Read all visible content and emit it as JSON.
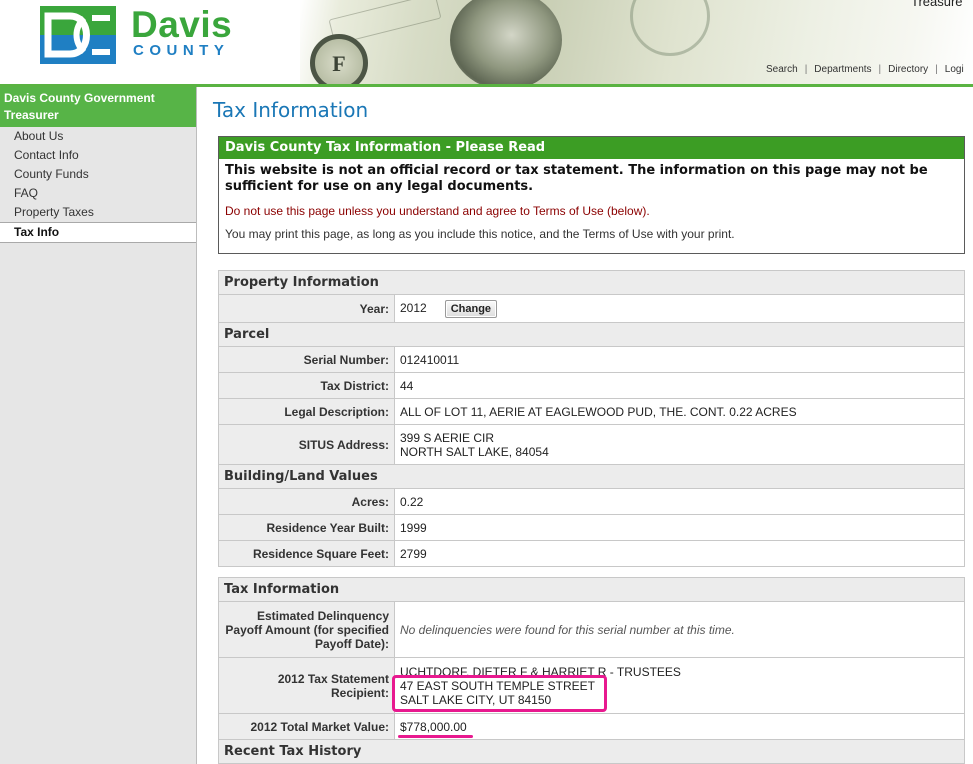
{
  "header": {
    "logo_davis": "Davis",
    "logo_county": "COUNTY",
    "top_right_text": "Treasure",
    "nav": [
      "Search",
      "Departments",
      "Directory",
      "Logi"
    ],
    "banner_seal_letter": "F",
    "accent_green": "#5ab342",
    "accent_blue": "#1f7fc3"
  },
  "sidebar": {
    "heading_line1": "Davis County Government",
    "heading_line2": "Treasurer",
    "items": [
      {
        "label": "About Us"
      },
      {
        "label": "Contact Info"
      },
      {
        "label": "County Funds"
      },
      {
        "label": "FAQ"
      },
      {
        "label": "Property Taxes"
      },
      {
        "label": "Tax Info",
        "active": true
      }
    ]
  },
  "main": {
    "page_title": "Tax Information",
    "notice": {
      "heading": "Davis County Tax Information - Please Read",
      "bold_text": "This website is not an official record or tax statement. The information on this page may not be sufficient for use on any legal documents.",
      "red_text": "Do not use this page unless you understand and agree to Terms of Use (below).",
      "plain_text": "You may print this page, as long as you include this notice, and the Terms of Use with your print."
    },
    "property": {
      "section_title": "Property Information",
      "year_label": "Year:",
      "year_value": "2012",
      "change_label": "Change",
      "parcel_title": "Parcel",
      "serial_label": "Serial Number:",
      "serial_value": "012410011",
      "district_label": "Tax District:",
      "district_value": "44",
      "legal_label": "Legal Description:",
      "legal_value": "ALL OF LOT 11, AERIE AT EAGLEWOOD PUD, THE. CONT. 0.22 ACRES",
      "situs_label": "SITUS Address:",
      "situs_line1": "399 S AERIE CIR",
      "situs_line2": "NORTH SALT LAKE, 84054",
      "building_title": "Building/Land Values",
      "acres_label": "Acres:",
      "acres_value": "0.22",
      "built_label": "Residence Year Built:",
      "built_value": "1999",
      "sqft_label": "Residence Square Feet:",
      "sqft_value": "2799"
    },
    "tax": {
      "section_title": "Tax Information",
      "delinquency_label": "Estimated Delinquency Payoff Amount (for specified Payoff Date):",
      "delinquency_value": "No delinquencies were found for this serial number at this time.",
      "recipient_label": "2012 Tax Statement Recipient:",
      "recipient_line1": "UCHTDORF, DIETER F & HARRIET R - TRUSTEES",
      "recipient_line2": "47 EAST SOUTH TEMPLE STREET",
      "recipient_line3": "SALT LAKE CITY, UT 84150",
      "market_label": "2012 Total Market Value:",
      "market_value": "$778,000.00",
      "history_title": "Recent Tax History"
    },
    "highlight_color": "#e8198f"
  }
}
